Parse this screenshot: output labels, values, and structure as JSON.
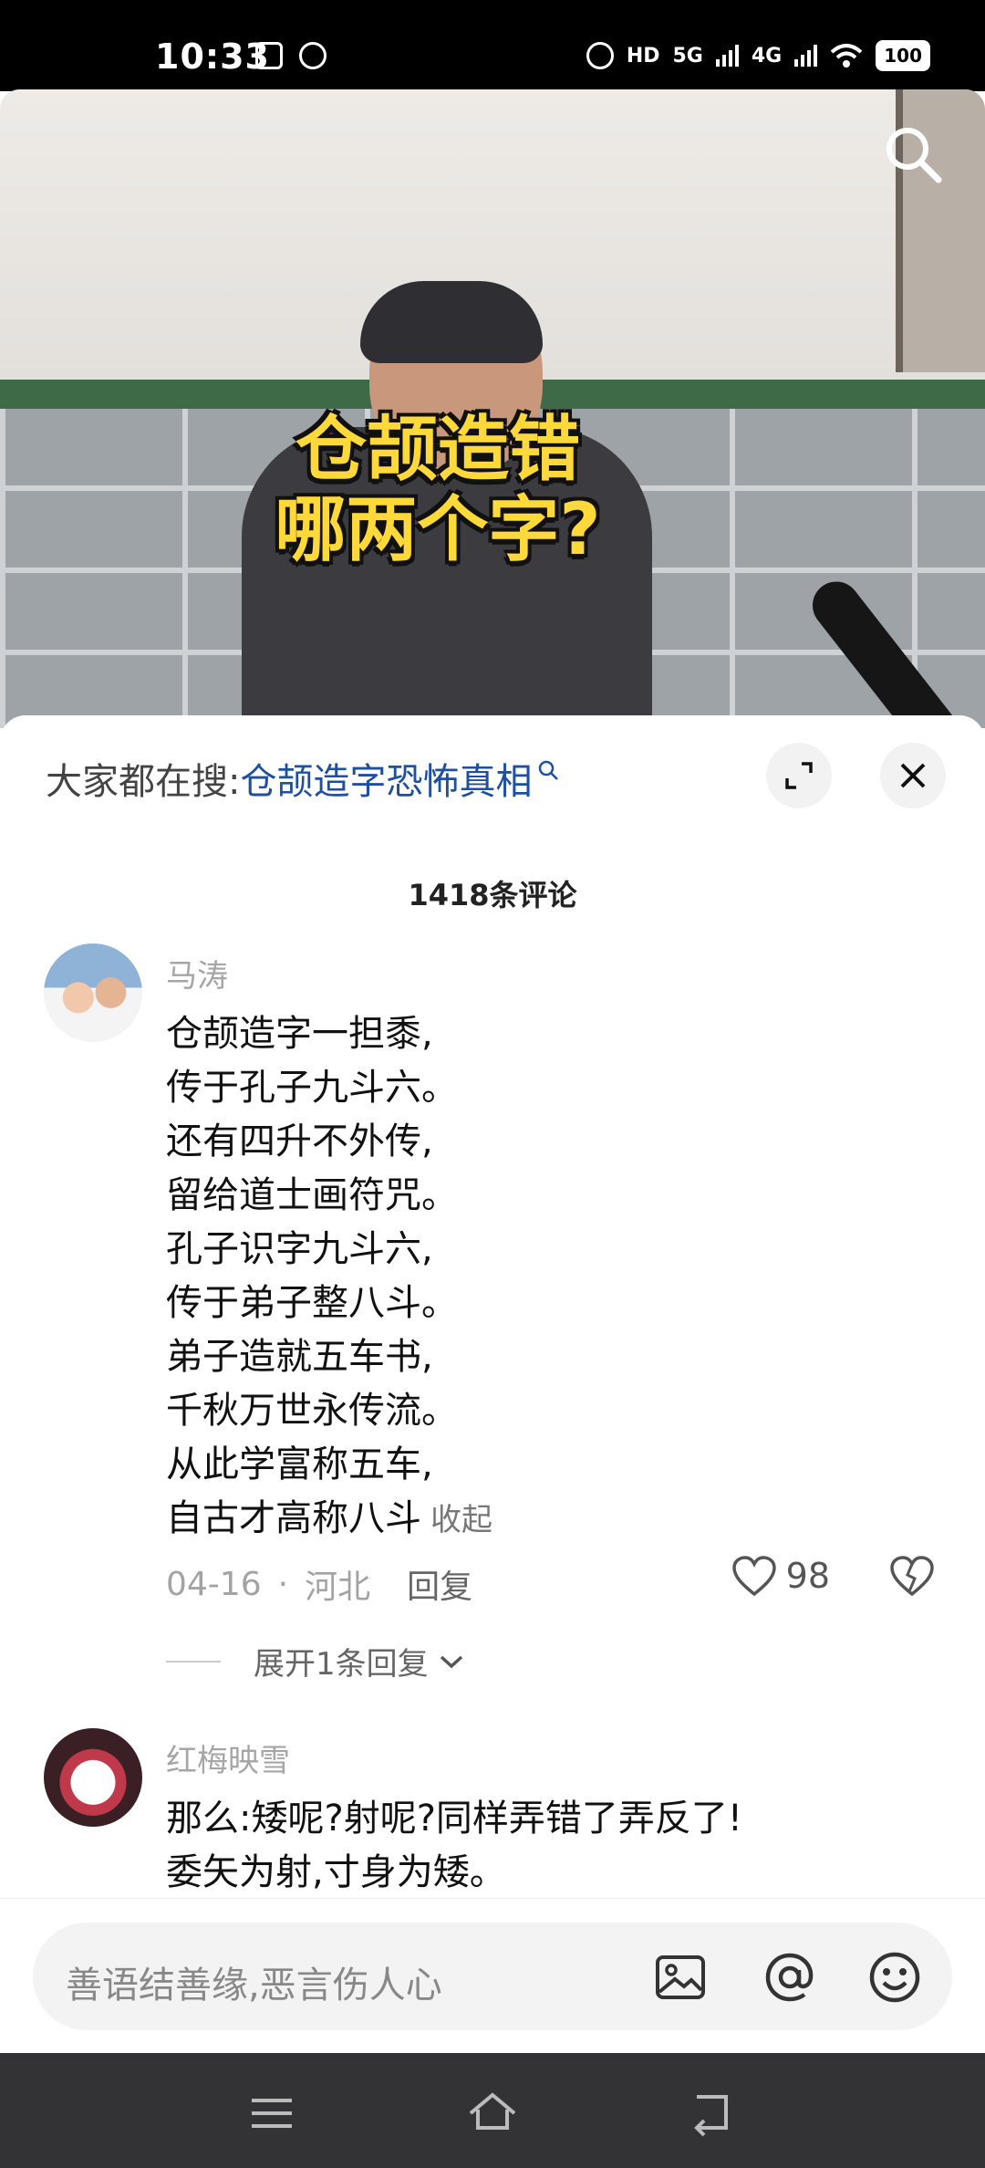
{
  "status_bar": {
    "time": "10:33",
    "hd_label": "HD",
    "net_5g": "5G",
    "net_4g": "4G",
    "battery": "100"
  },
  "video": {
    "caption_line1": "仓颉造错",
    "caption_line2": "哪两个字?"
  },
  "search_hint": {
    "label": "大家都在搜:",
    "query": "仓颉造字恐怖真相"
  },
  "comments_header": {
    "count_text": "1418条评论"
  },
  "comments": [
    {
      "user": "马涛",
      "lines": [
        "仓颉造字一担黍,",
        "传于孔子九斗六。",
        "还有四升不外传,",
        "留给道士画符咒。",
        "孔子识字九斗六,",
        "传于弟子整八斗。",
        "弟子造就五车书,",
        "千秋万世永传流。",
        "从此学富称五车,",
        "自古才高称八斗"
      ],
      "collapse_label": "收起",
      "date": "04-16",
      "separator": "·",
      "location": "河北",
      "reply_label": "回复",
      "likes": "98",
      "expand_replies_label": "展开1条回复"
    },
    {
      "user": "红梅映雪",
      "lines": [
        "那么:矮呢?射呢?同样弄错了弄反了!",
        "委矢为射,寸身为矮。"
      ]
    }
  ],
  "input_bar": {
    "placeholder": "善语结善缘,恶言伤人心"
  },
  "colors": {
    "link_blue": "#1f4fa0",
    "caption_yellow": "#ffd83a",
    "nav_bar_bg": "#333335"
  },
  "icons": [
    "search-icon",
    "expand-icon",
    "close-icon",
    "heart-icon",
    "broken-heart-icon",
    "chevron-down-icon",
    "image-icon",
    "at-icon",
    "emoji-icon",
    "menu-icon",
    "home-icon",
    "back-icon"
  ]
}
